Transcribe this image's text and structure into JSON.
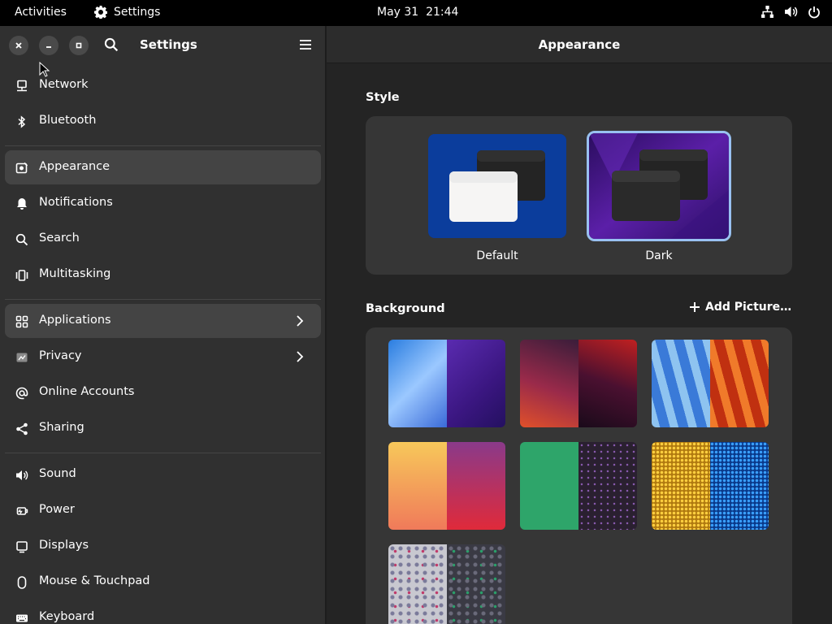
{
  "topbar": {
    "activities": "Activities",
    "app_name": "Settings",
    "clock": "May 31  21:44",
    "icons": [
      "network-wired-icon",
      "volume-icon",
      "power-icon"
    ]
  },
  "sidebar": {
    "title": "Settings",
    "items": [
      {
        "label": "Network",
        "icon": "network-icon"
      },
      {
        "label": "Bluetooth",
        "icon": "bluetooth-icon"
      },
      {
        "label": "Appearance",
        "icon": "appearance-icon",
        "active": true
      },
      {
        "label": "Notifications",
        "icon": "bell-icon"
      },
      {
        "label": "Search",
        "icon": "search-icon"
      },
      {
        "label": "Multitasking",
        "icon": "multitasking-icon"
      },
      {
        "label": "Applications",
        "icon": "apps-grid-icon",
        "chevron": true
      },
      {
        "label": "Privacy",
        "icon": "privacy-icon",
        "chevron": true
      },
      {
        "label": "Online Accounts",
        "icon": "at-icon"
      },
      {
        "label": "Sharing",
        "icon": "share-icon"
      },
      {
        "label": "Sound",
        "icon": "speaker-icon"
      },
      {
        "label": "Power",
        "icon": "power-plug-icon"
      },
      {
        "label": "Displays",
        "icon": "display-icon"
      },
      {
        "label": "Mouse & Touchpad",
        "icon": "mouse-icon"
      },
      {
        "label": "Keyboard",
        "icon": "keyboard-icon"
      }
    ]
  },
  "main": {
    "title": "Appearance",
    "style": {
      "heading": "Style",
      "options": [
        {
          "label": "Default",
          "selected": false
        },
        {
          "label": "Dark",
          "selected": true
        }
      ]
    },
    "background": {
      "heading": "Background",
      "add_label": "Add Picture…"
    }
  },
  "colors": {
    "accent": "#99c1f1",
    "sidebar_bg": "#303030",
    "main_bg": "#242424",
    "card_bg": "#363636"
  }
}
